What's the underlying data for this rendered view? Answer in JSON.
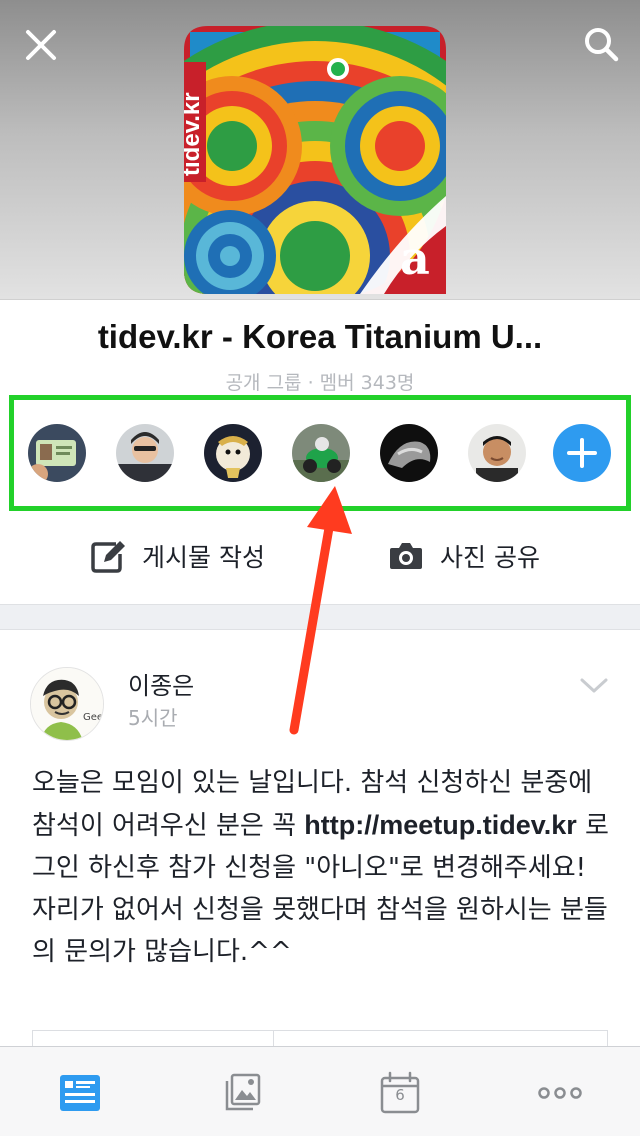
{
  "header": {
    "close_icon": "close-icon",
    "search_icon": "search-icon",
    "logo_text": "tidev.kr",
    "logo_badge": "a"
  },
  "group": {
    "title": "tidev.kr - Korea Titanium U...",
    "meta": "공개 그룹 · 멤버 343명"
  },
  "members": {
    "count_visible": 6,
    "online_member_index": 3,
    "add_icon": "plus-icon"
  },
  "actions": {
    "write_label": "게시물 작성",
    "write_icon": "compose-icon",
    "photo_label": "사진 공유",
    "photo_icon": "camera-icon"
  },
  "post": {
    "author": "이종은",
    "time": "5시간",
    "body_before_link": "오늘은 모임이 있는 날입니다. 참석 신청하신 분중에 참석이 어려우신 분은 꼭 ",
    "link": "http://meetup.tidev.kr",
    "body_after_link": " 로그인 하신후 참가 신청을 \"아니오\"로 변경해주세요! 자리가 없어서 신청을 못했다며 참석을 원하시는 분들의 문의가 많습니다.^^",
    "avatar_caption": "Geek"
  },
  "tabbar": {
    "feed_icon": "news-feed-icon",
    "photos_icon": "photos-icon",
    "events_icon": "calendar-icon",
    "events_badge": "6",
    "more_icon": "more-icon"
  },
  "colors": {
    "accent": "#2e9bf0",
    "highlight_border": "#22d12a",
    "arrow": "#ff3b1f",
    "online": "#23b14d"
  }
}
